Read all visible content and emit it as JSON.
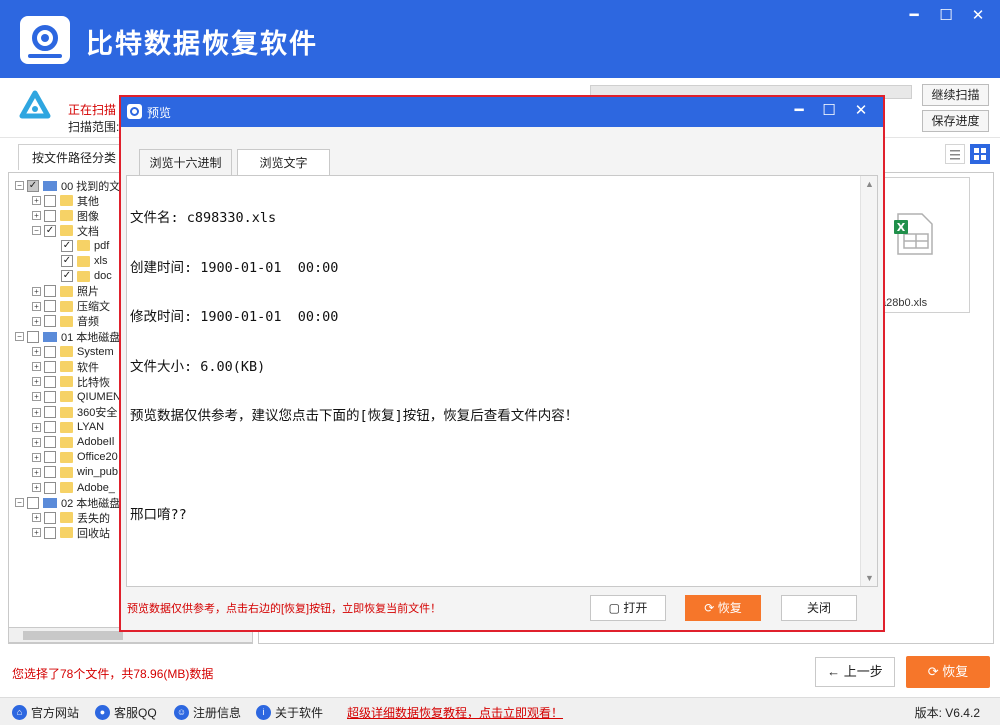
{
  "app": {
    "title": "比特数据恢复软件",
    "window_controls": [
      "minimize",
      "maximize",
      "close"
    ]
  },
  "scan": {
    "status": "正在扫描",
    "range_label": "扫描范围:",
    "continue_button": "继续扫描",
    "save_button": "保存进度"
  },
  "tabs": {
    "by_path": "按文件路径分类"
  },
  "tree": [
    {
      "label": "00 找到的文",
      "level": 0,
      "checked": "partial",
      "icon": "disk"
    },
    {
      "label": "其他",
      "level": 1,
      "checked": false,
      "icon": "folder"
    },
    {
      "label": "图像",
      "level": 1,
      "checked": false,
      "icon": "folder"
    },
    {
      "label": "文档",
      "level": 1,
      "checked": "checked",
      "icon": "folder"
    },
    {
      "label": "pdf",
      "level": 2,
      "checked": "checked",
      "icon": "folder"
    },
    {
      "label": "xls",
      "level": 2,
      "checked": "checked",
      "icon": "folder"
    },
    {
      "label": "doc",
      "level": 2,
      "checked": "checked",
      "icon": "folder"
    },
    {
      "label": "照片",
      "level": 1,
      "checked": false,
      "icon": "folder"
    },
    {
      "label": "压缩文",
      "level": 1,
      "checked": false,
      "icon": "folder"
    },
    {
      "label": "音频",
      "level": 1,
      "checked": false,
      "icon": "folder"
    },
    {
      "label": "01 本地磁盘",
      "level": 0,
      "checked": false,
      "icon": "disk"
    },
    {
      "label": "System",
      "level": 1,
      "checked": false,
      "icon": "folder"
    },
    {
      "label": "软件",
      "level": 1,
      "checked": false,
      "icon": "folder"
    },
    {
      "label": "比特恢",
      "level": 1,
      "checked": false,
      "icon": "folder"
    },
    {
      "label": "QIUMEN",
      "level": 1,
      "checked": false,
      "icon": "folder"
    },
    {
      "label": "360安全",
      "level": 1,
      "checked": false,
      "icon": "folder"
    },
    {
      "label": "LYAN",
      "level": 1,
      "checked": false,
      "icon": "folder"
    },
    {
      "label": "AdobeIl",
      "level": 1,
      "checked": false,
      "icon": "folder"
    },
    {
      "label": "Office20",
      "level": 1,
      "checked": false,
      "icon": "folder"
    },
    {
      "label": "win_pub",
      "level": 1,
      "checked": false,
      "icon": "folder"
    },
    {
      "label": "Adobe_",
      "level": 1,
      "checked": false,
      "icon": "folder"
    },
    {
      "label": "02 本地磁盘",
      "level": 0,
      "checked": false,
      "icon": "disk"
    },
    {
      "label": "丢失的",
      "level": 1,
      "checked": false,
      "icon": "folder"
    },
    {
      "label": "回收站",
      "level": 1,
      "checked": false,
      "icon": "folder"
    }
  ],
  "file_panel": {
    "visible_file": "a28b0.xls",
    "file_icon": "excel-file-icon"
  },
  "status": {
    "selection": "您选择了78个文件，共78.96(MB)数据",
    "prev_button": "上一步",
    "recover_button": "恢复"
  },
  "footer": {
    "links": [
      "官方网站",
      "客服QQ",
      "注册信息",
      "关于软件"
    ],
    "tutorial": "超级详细数据恢复教程，点击立即观看！",
    "version": "版本: V6.4.2"
  },
  "dialog": {
    "title": "预览",
    "tab_hex": "浏览十六进制",
    "tab_text": "浏览文字",
    "content": [
      "文件名: c898330.xls",
      "创建时间: 1900-01-01  00:00",
      "修改时间: 1900-01-01  00:00",
      "文件大小: 6.00(KB)",
      "预览数据仅供参考，建议您点击下面的[恢复]按钮，恢复后查看文件内容！",
      "",
      "邢口唷??"
    ],
    "note": "预览数据仅供参考，点击右边的[恢复]按钮，立即恢复当前文件！",
    "open_button": "打开",
    "recover_button": "恢复",
    "close_button": "关闭"
  },
  "colors": {
    "brand_blue": "#2d67e0",
    "accent_orange": "#f6762a",
    "alert_red": "#d40000"
  }
}
